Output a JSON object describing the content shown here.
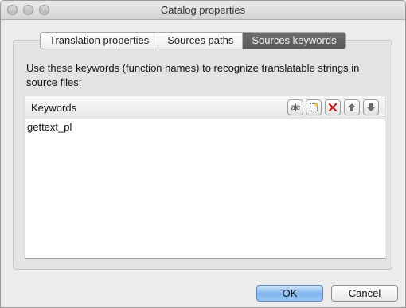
{
  "window": {
    "title": "Catalog properties"
  },
  "tabs": [
    {
      "label": "Translation properties",
      "selected": false
    },
    {
      "label": "Sources paths",
      "selected": false
    },
    {
      "label": "Sources keywords",
      "selected": true
    }
  ],
  "description": "Use these keywords (function names) to recognize translatable strings in source files:",
  "keywords": {
    "header": "Keywords",
    "toolbar": {
      "edit": "a|e",
      "new_icon": "new-item-icon",
      "delete_icon": "delete-icon",
      "move_up_icon": "move-up-icon",
      "move_down_icon": "move-down-icon"
    },
    "items": [
      "gettext_pl"
    ]
  },
  "buttons": {
    "ok": "OK",
    "cancel": "Cancel"
  }
}
